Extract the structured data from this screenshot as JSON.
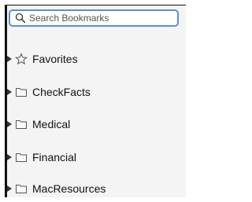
{
  "search": {
    "placeholder": "Search Bookmarks",
    "icon": "search-icon"
  },
  "tree": {
    "items": [
      {
        "label": "Favorites",
        "icon": "star-icon",
        "expanded": false
      },
      {
        "label": "CheckFacts",
        "icon": "folder-icon",
        "expanded": false
      },
      {
        "label": "Medical",
        "icon": "folder-icon",
        "expanded": false
      },
      {
        "label": "Financial",
        "icon": "folder-icon",
        "expanded": false
      },
      {
        "label": "MacResources",
        "icon": "folder-icon",
        "expanded": false
      }
    ]
  },
  "colors": {
    "focus_ring": "#5a8fd6",
    "sidebar_bg": "#f4f4f4"
  }
}
